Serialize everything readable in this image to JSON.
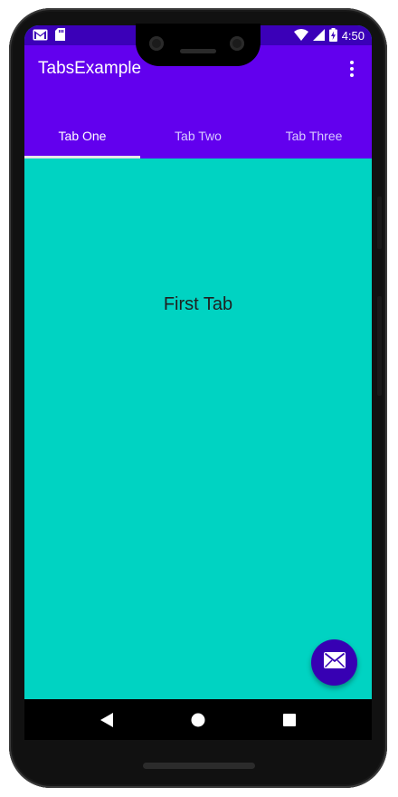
{
  "status_bar": {
    "time": "4:50",
    "left_icons": [
      "gmail-icon",
      "sd-card-icon"
    ],
    "right_icons": [
      "wifi-icon",
      "signal-icon",
      "battery-charging-icon"
    ]
  },
  "app_bar": {
    "title": "TabsExample",
    "overflow_icon": "more-vert-icon"
  },
  "tabs": [
    {
      "label": "Tab One",
      "selected": true
    },
    {
      "label": "Tab Two",
      "selected": false
    },
    {
      "label": "Tab Three",
      "selected": false
    }
  ],
  "content": {
    "label": "First Tab"
  },
  "fab": {
    "icon": "mail-icon"
  },
  "nav_bar": {
    "buttons": [
      "back-icon",
      "home-icon",
      "recents-icon"
    ]
  },
  "colors": {
    "status_bar": "#3b00b8",
    "app_bar": "#6200ee",
    "content_background": "#00d3c2",
    "fab": "#3700b3",
    "tab_indicator": "#e6e6e6"
  }
}
